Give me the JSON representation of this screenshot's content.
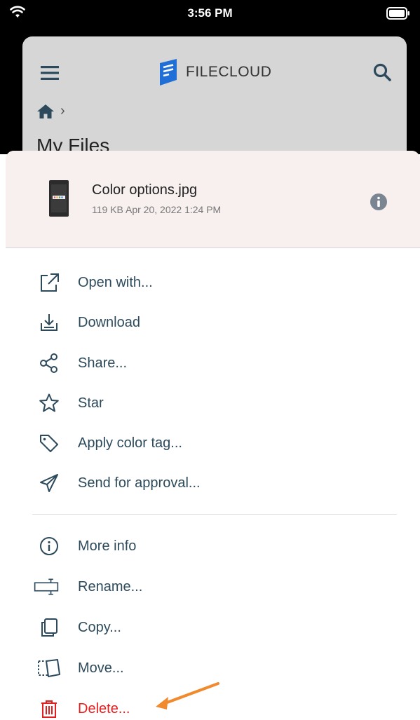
{
  "status_bar": {
    "time": "3:56 PM"
  },
  "header": {
    "logo_text": "FILECLOUD",
    "page_title": "My Files"
  },
  "file": {
    "name": "Color options.jpg",
    "meta": "119 KB Apr 20, 2022 1:24 PM"
  },
  "menu": {
    "open_with": "Open with...",
    "download": "Download",
    "share": "Share...",
    "star": "Star",
    "apply_color_tag": "Apply color tag...",
    "send_for_approval": "Send for approval...",
    "more_info": "More info",
    "rename": "Rename...",
    "copy": "Copy...",
    "move": "Move...",
    "delete": "Delete..."
  },
  "colors": {
    "accent_text": "#2d4a5c",
    "danger": "#e21e1e",
    "annotation_arrow": "#f08a2c",
    "logo_blue": "#1f6fd6"
  }
}
